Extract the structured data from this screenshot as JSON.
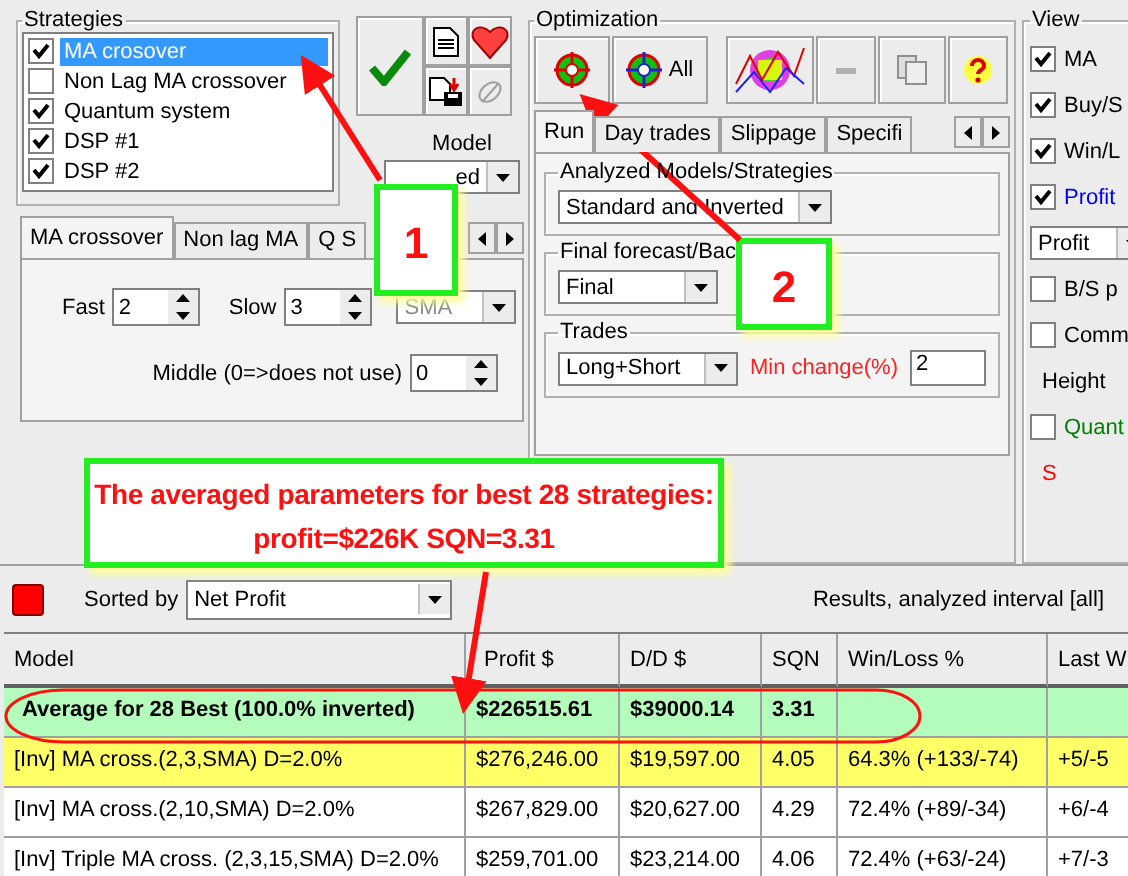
{
  "strategies": {
    "title": "Strategies",
    "items": [
      {
        "label": "MA crosover",
        "checked": true,
        "selected": true
      },
      {
        "label": "Non Lag MA crossover",
        "checked": false,
        "selected": false
      },
      {
        "label": "Quantum system",
        "checked": true,
        "selected": false
      },
      {
        "label": "DSP #1",
        "checked": true,
        "selected": false
      },
      {
        "label": "DSP #2",
        "checked": true,
        "selected": false
      }
    ]
  },
  "model": {
    "label": "Model",
    "value": "ed"
  },
  "strategy_tabs": [
    {
      "label": "MA crossover",
      "selected": true
    },
    {
      "label": "Non lag MA",
      "selected": false
    },
    {
      "label": "Q S",
      "selected": false
    }
  ],
  "parameters": [
    {
      "label": "Fast",
      "value": "2"
    },
    {
      "label": "Slow",
      "value": "3"
    }
  ],
  "ma_type": "SMA",
  "middle": {
    "label": "Middle (0=>does not use)",
    "value": "0"
  },
  "optimization": {
    "title": "Optimization",
    "all_button": "All",
    "tabs": [
      {
        "label": "Run",
        "selected": true
      },
      {
        "label": "Day trades",
        "selected": false
      },
      {
        "label": "Slippage",
        "selected": false
      },
      {
        "label": "Specifi",
        "selected": false
      }
    ],
    "analyzed": {
      "title": "Analyzed Models/Strategies",
      "value": "Standard and Inverted"
    },
    "final": {
      "title": "Final forecast/Bac",
      "value": "Final"
    },
    "trades": {
      "title": "Trades",
      "value": "Long+Short",
      "min_change_label": "Min change(%)",
      "min_change": "2"
    }
  },
  "view": {
    "title": "View",
    "items": [
      {
        "kind": "checkbox",
        "label": "MA",
        "checked": true,
        "color": "#000000"
      },
      {
        "kind": "checkbox",
        "label": "Buy/S",
        "checked": true,
        "color": "#000000"
      },
      {
        "kind": "checkbox",
        "label": "Win/L",
        "checked": true,
        "color": "#000000"
      },
      {
        "kind": "checkbox",
        "label": "Profit",
        "checked": true,
        "color": "#0000ff"
      },
      {
        "kind": "combo",
        "label": "Profit",
        "color": "#000000"
      },
      {
        "kind": "checkbox",
        "label": "B/S p",
        "checked": false,
        "color": "#000000"
      },
      {
        "kind": "checkbox",
        "label": "Comm",
        "checked": false,
        "color": "#000000"
      },
      {
        "kind": "label",
        "label": "Height",
        "color": "#000000"
      },
      {
        "kind": "checkbox",
        "label": "Quant",
        "checked": false,
        "color": "#008000"
      },
      {
        "kind": "label",
        "label": "S",
        "color": "#ff0000"
      }
    ]
  },
  "sort": {
    "label": "Sorted by",
    "value": "Net Profit"
  },
  "results_caption": "Results, analyzed interval [all]",
  "table": {
    "columns": [
      "Model",
      "Profit $",
      "D/D $",
      "SQN",
      "Win/Loss %",
      "Last W"
    ],
    "rows": [
      {
        "kind": "average",
        "cells": [
          "Average for 28 Best (100.0% inverted)",
          "$226515.61",
          "$39000.14",
          "3.31",
          "",
          ""
        ]
      },
      {
        "kind": "best",
        "cells": [
          "[Inv] MA cross.(2,3,SMA) D=2.0%",
          "$276,246.00",
          "$19,597.00",
          "4.05",
          "64.3% (+133/-74)",
          "+5/-5"
        ]
      },
      {
        "kind": "normal",
        "cells": [
          "[Inv] MA cross.(2,10,SMA) D=2.0%",
          "$267,829.00",
          "$20,627.00",
          "4.29",
          "72.4% (+89/-34)",
          "+6/-4"
        ]
      },
      {
        "kind": "normal",
        "cells": [
          "[Inv] Triple MA cross. (2,3,15,SMA) D=2.0%",
          "$259,701.00",
          "$23,214.00",
          "4.06",
          "72.4% (+63/-24)",
          "+7/-3"
        ]
      }
    ]
  },
  "callouts": [
    {
      "kind": "number",
      "text": "1"
    },
    {
      "kind": "number",
      "text": "2"
    },
    {
      "kind": "note",
      "lines": [
        "The averaged parameters for best 28 strategies:",
        "profit=$226K SQN=3.31"
      ]
    }
  ]
}
